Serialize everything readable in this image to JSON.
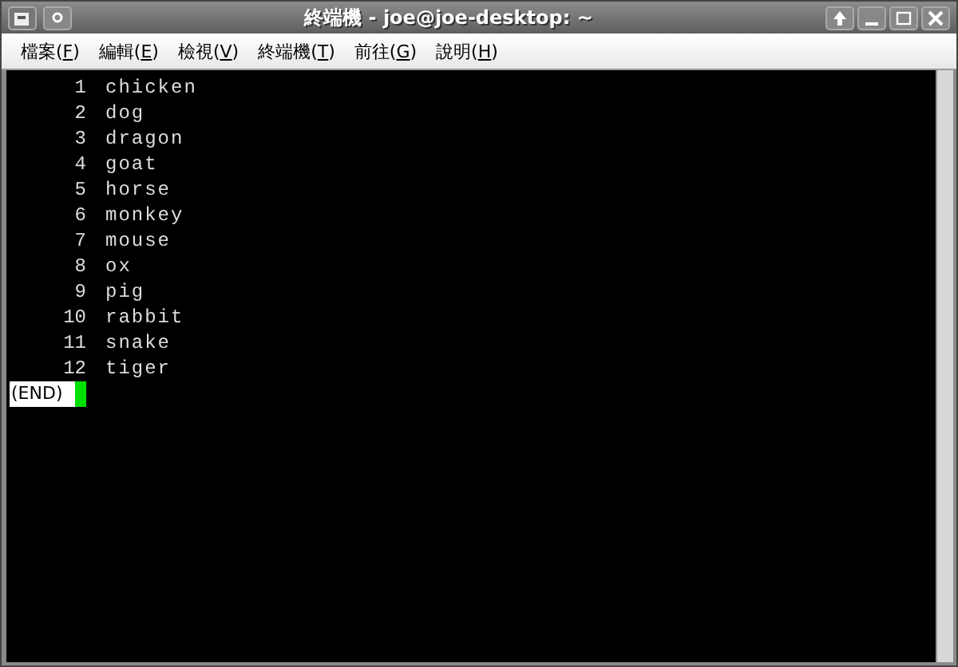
{
  "window": {
    "title": "終端機 - joe@joe-desktop: ~"
  },
  "menu": [
    {
      "before": "檔案(",
      "key": "F",
      "after": ")"
    },
    {
      "before": "編輯(",
      "key": "E",
      "after": ")"
    },
    {
      "before": "檢視(",
      "key": "V",
      "after": ")"
    },
    {
      "before": "終端機(",
      "key": "T",
      "after": ")"
    },
    {
      "before": "前往(",
      "key": "G",
      "after": ")"
    },
    {
      "before": "說明(",
      "key": "H",
      "after": ")"
    }
  ],
  "terminal": {
    "lines": [
      {
        "number": "1",
        "text": "chicken"
      },
      {
        "number": "2",
        "text": "dog"
      },
      {
        "number": "3",
        "text": "dragon"
      },
      {
        "number": "4",
        "text": "goat"
      },
      {
        "number": "5",
        "text": "horse"
      },
      {
        "number": "6",
        "text": "monkey"
      },
      {
        "number": "7",
        "text": "mouse"
      },
      {
        "number": "8",
        "text": "ox"
      },
      {
        "number": "9",
        "text": "pig"
      },
      {
        "number": "10",
        "text": "rabbit"
      },
      {
        "number": "11",
        "text": "snake"
      },
      {
        "number": "12",
        "text": "tiger"
      }
    ],
    "prompt": "(END)"
  }
}
